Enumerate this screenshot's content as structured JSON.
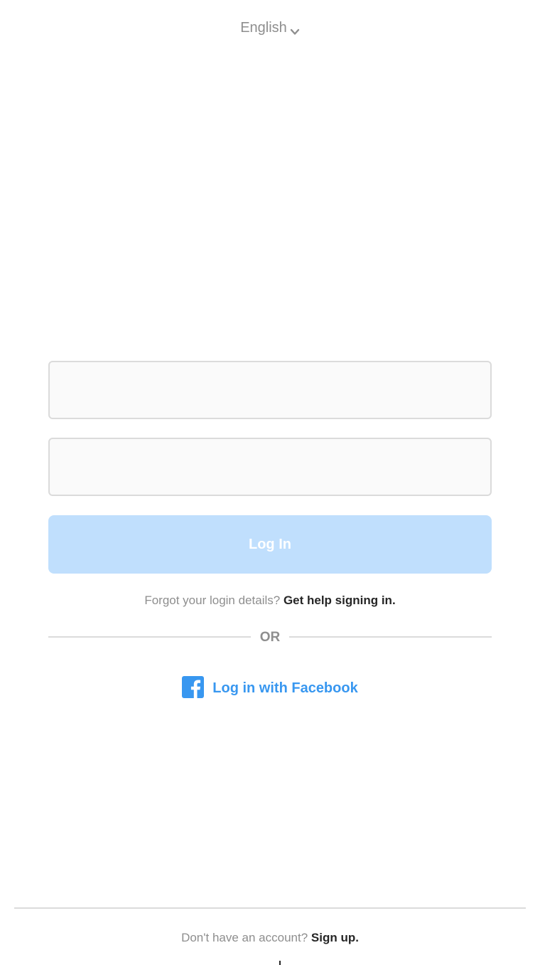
{
  "language": {
    "selected": "English",
    "icon": "chevron-down-icon"
  },
  "form": {
    "username_value": "",
    "password_value": "",
    "login_label": "Log In"
  },
  "help": {
    "prompt": "Forgot your login details?",
    "link": "Get help signing in."
  },
  "divider": {
    "label": "OR"
  },
  "facebook": {
    "label": "Log in with Facebook",
    "icon": "facebook-icon",
    "color": "#3897f0"
  },
  "footer": {
    "prompt": "Don't have an account?",
    "link": "Sign up."
  },
  "colors": {
    "login_button_disabled": "#c0dffd",
    "field_border": "#dbdbdb",
    "field_background": "#fafafa",
    "muted_text": "#8e8e8e",
    "dark_text": "#262626"
  }
}
